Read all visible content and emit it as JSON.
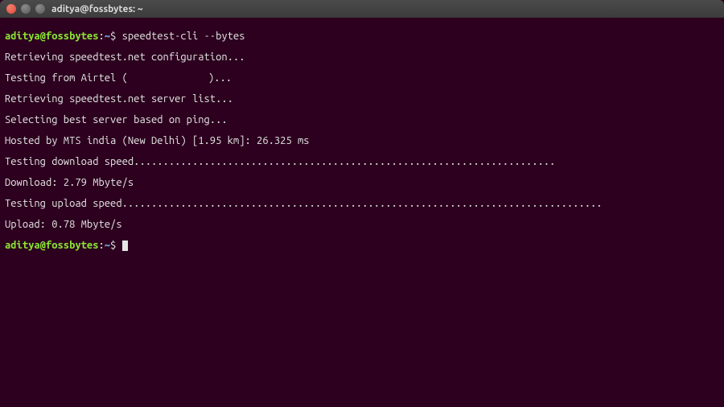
{
  "window": {
    "title": "aditya@fossbytes: ~"
  },
  "prompt": {
    "userhost": "aditya@fossbytes",
    "path": "~",
    "symbol": "$"
  },
  "session": {
    "command1": "speedtest-cli --bytes",
    "lines": {
      "l1": "Retrieving speedtest.net configuration...",
      "l2a": "Testing from Airtel (",
      "l2b": ")...",
      "l3": "Retrieving speedtest.net server list...",
      "l4": "Selecting best server based on ping...",
      "l5": "Hosted by MTS india (New Delhi) [1.95 km]: 26.325 ms",
      "l6": "Testing download speed........................................................................",
      "l7": "Download: 2.79 Mbyte/s",
      "l8": "Testing upload speed..................................................................................",
      "l9": "Upload: 0.78 Mbyte/s"
    }
  }
}
